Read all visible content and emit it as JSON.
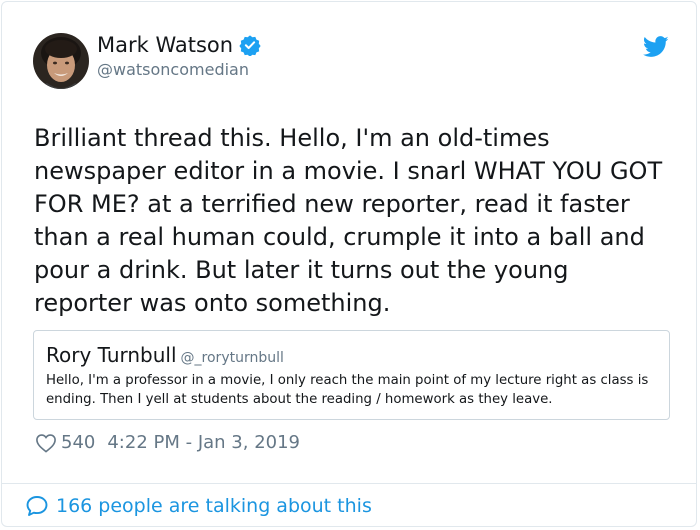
{
  "author": {
    "name": "Mark Watson",
    "handle": "@watsoncomedian",
    "verified": true,
    "avatar": "avatar-photo"
  },
  "tweet": {
    "text": "Brilliant thread this. Hello, I'm an old-times newspaper editor in a movie. I snarl WHAT YOU GOT FOR ME? at a terrified new reporter, read it faster than a real human could, crumple it into a ball and pour a drink. But later it turns out the young reporter was onto something."
  },
  "quoted_tweet": {
    "name": "Rory Turnbull",
    "handle": "@_roryturnbull",
    "text": "Hello, I'm a professor in a movie, I only reach the main point of my lecture right as class is ending. Then I yell at students about the reading / homework as they leave."
  },
  "meta": {
    "likes": "540",
    "timestamp": "4:22 PM - Jan 3, 2019"
  },
  "footer": {
    "talking_text": "166 people are talking about this"
  },
  "icons": {
    "verified": "verified-badge-icon",
    "platform": "twitter-bird-icon",
    "like": "heart-icon",
    "reply": "speech-bubble-icon"
  },
  "colors": {
    "brand_blue": "#1da1f2",
    "link_blue": "#1b95e0",
    "muted_text": "#657786",
    "border": "#e1e8ed"
  }
}
